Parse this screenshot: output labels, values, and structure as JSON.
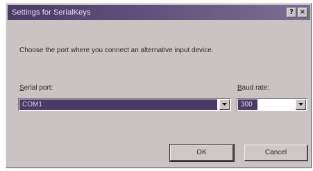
{
  "window": {
    "title": "Settings for SerialKeys",
    "help_label": "?",
    "close_label": "×"
  },
  "description": "Choose the port where you connect an alternative input device.",
  "serial_port": {
    "label_accel": "S",
    "label_rest": "erial port:",
    "value": "COM1"
  },
  "baud_rate": {
    "label_accel": "B",
    "label_rest": "aud rate:",
    "value": "300"
  },
  "buttons": {
    "ok": "OK",
    "cancel": "Cancel"
  },
  "colors": {
    "titlebar": "#4a3a68",
    "dialog_face": "#c9c3c3",
    "selection": "#4a3a68"
  }
}
